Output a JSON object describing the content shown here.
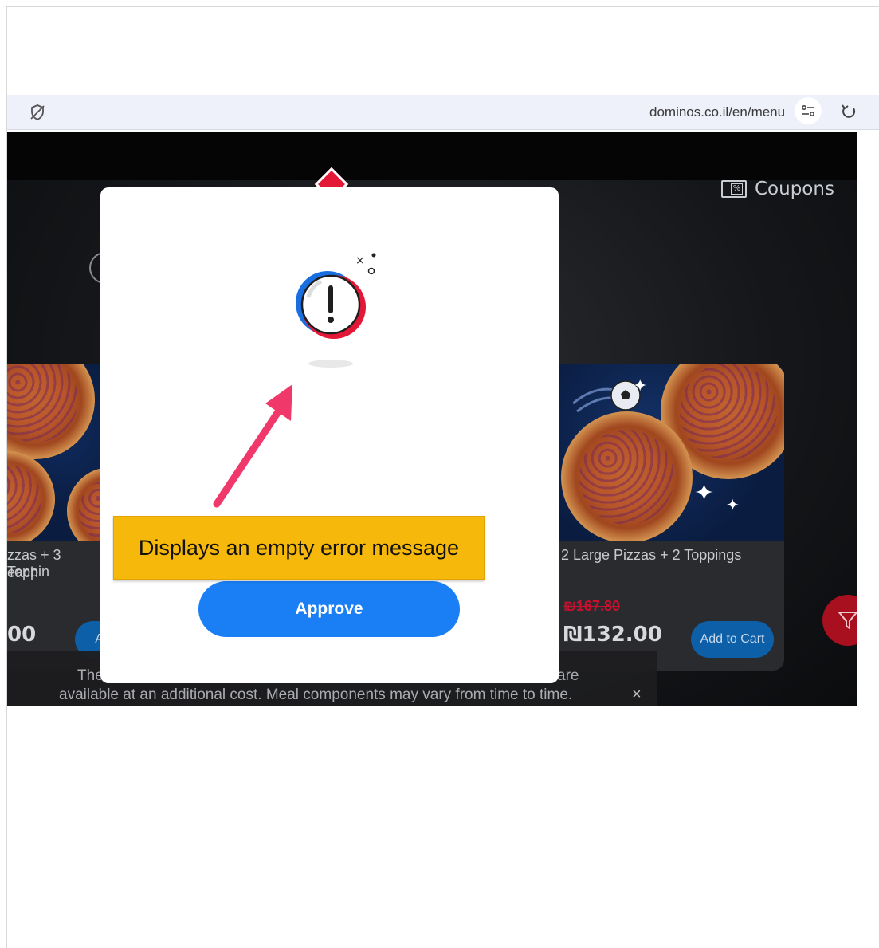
{
  "browser": {
    "url": "dominos.co.il/en/menu",
    "icons": {
      "shield": "tracking-protection-off-icon",
      "tune": "site-settings-icon",
      "reload": "reload-icon"
    }
  },
  "site": {
    "coupons_label": "Coupons",
    "cards": [
      {
        "title_line1": "zzas + 3 Toppin",
        "title_line2": " each",
        "price": "00",
        "add_label": "Ad"
      },
      {
        "title_line1": "2 Large Pizzas + 2 Toppings",
        "old_price": "₪167.80",
        "price": "₪132.00",
        "add_label": "Add to Cart"
      }
    ],
    "notice": {
      "line1_left": "The",
      "line1_right": "are",
      "line2": "available at an additional cost. Meal components may vary from time to time.",
      "close": "×"
    }
  },
  "modal": {
    "icon": "exclamation-alert-icon",
    "approve_label": "Approve"
  },
  "annotation": {
    "text": "Displays an empty error message",
    "color": "#f6b80a",
    "arrow_color": "#f0386b"
  },
  "colors": {
    "approve_blue": "#1a7ff5",
    "brand_red": "#e31837",
    "brand_blue": "#1a6fe0"
  }
}
